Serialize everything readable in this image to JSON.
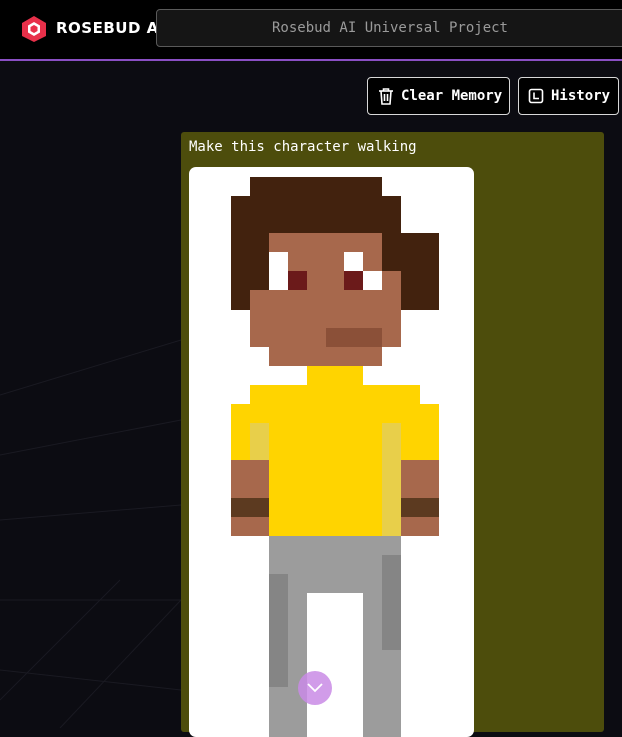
{
  "header": {
    "brand": "ROSEBUD AI",
    "project_name": "Rosebud AI Universal Project"
  },
  "toolbar": {
    "clear_memory_label": "Clear Memory",
    "history_label": "History"
  },
  "message": {
    "prompt": "Make this character walking"
  },
  "icons": {
    "logo": "rosebud-logo-icon",
    "clear": "trash-icon",
    "history": "history-icon",
    "scroll": "chevron-down-icon"
  },
  "colors": {
    "accent": "#8a4fc4",
    "logo": "#e8304a",
    "card": "#4d4d0c",
    "shirt": "#ffd400",
    "hair": "#42220e",
    "skin": "#a7684c",
    "pants": "#9c9c9c",
    "scroll_button": "#c98be6"
  }
}
